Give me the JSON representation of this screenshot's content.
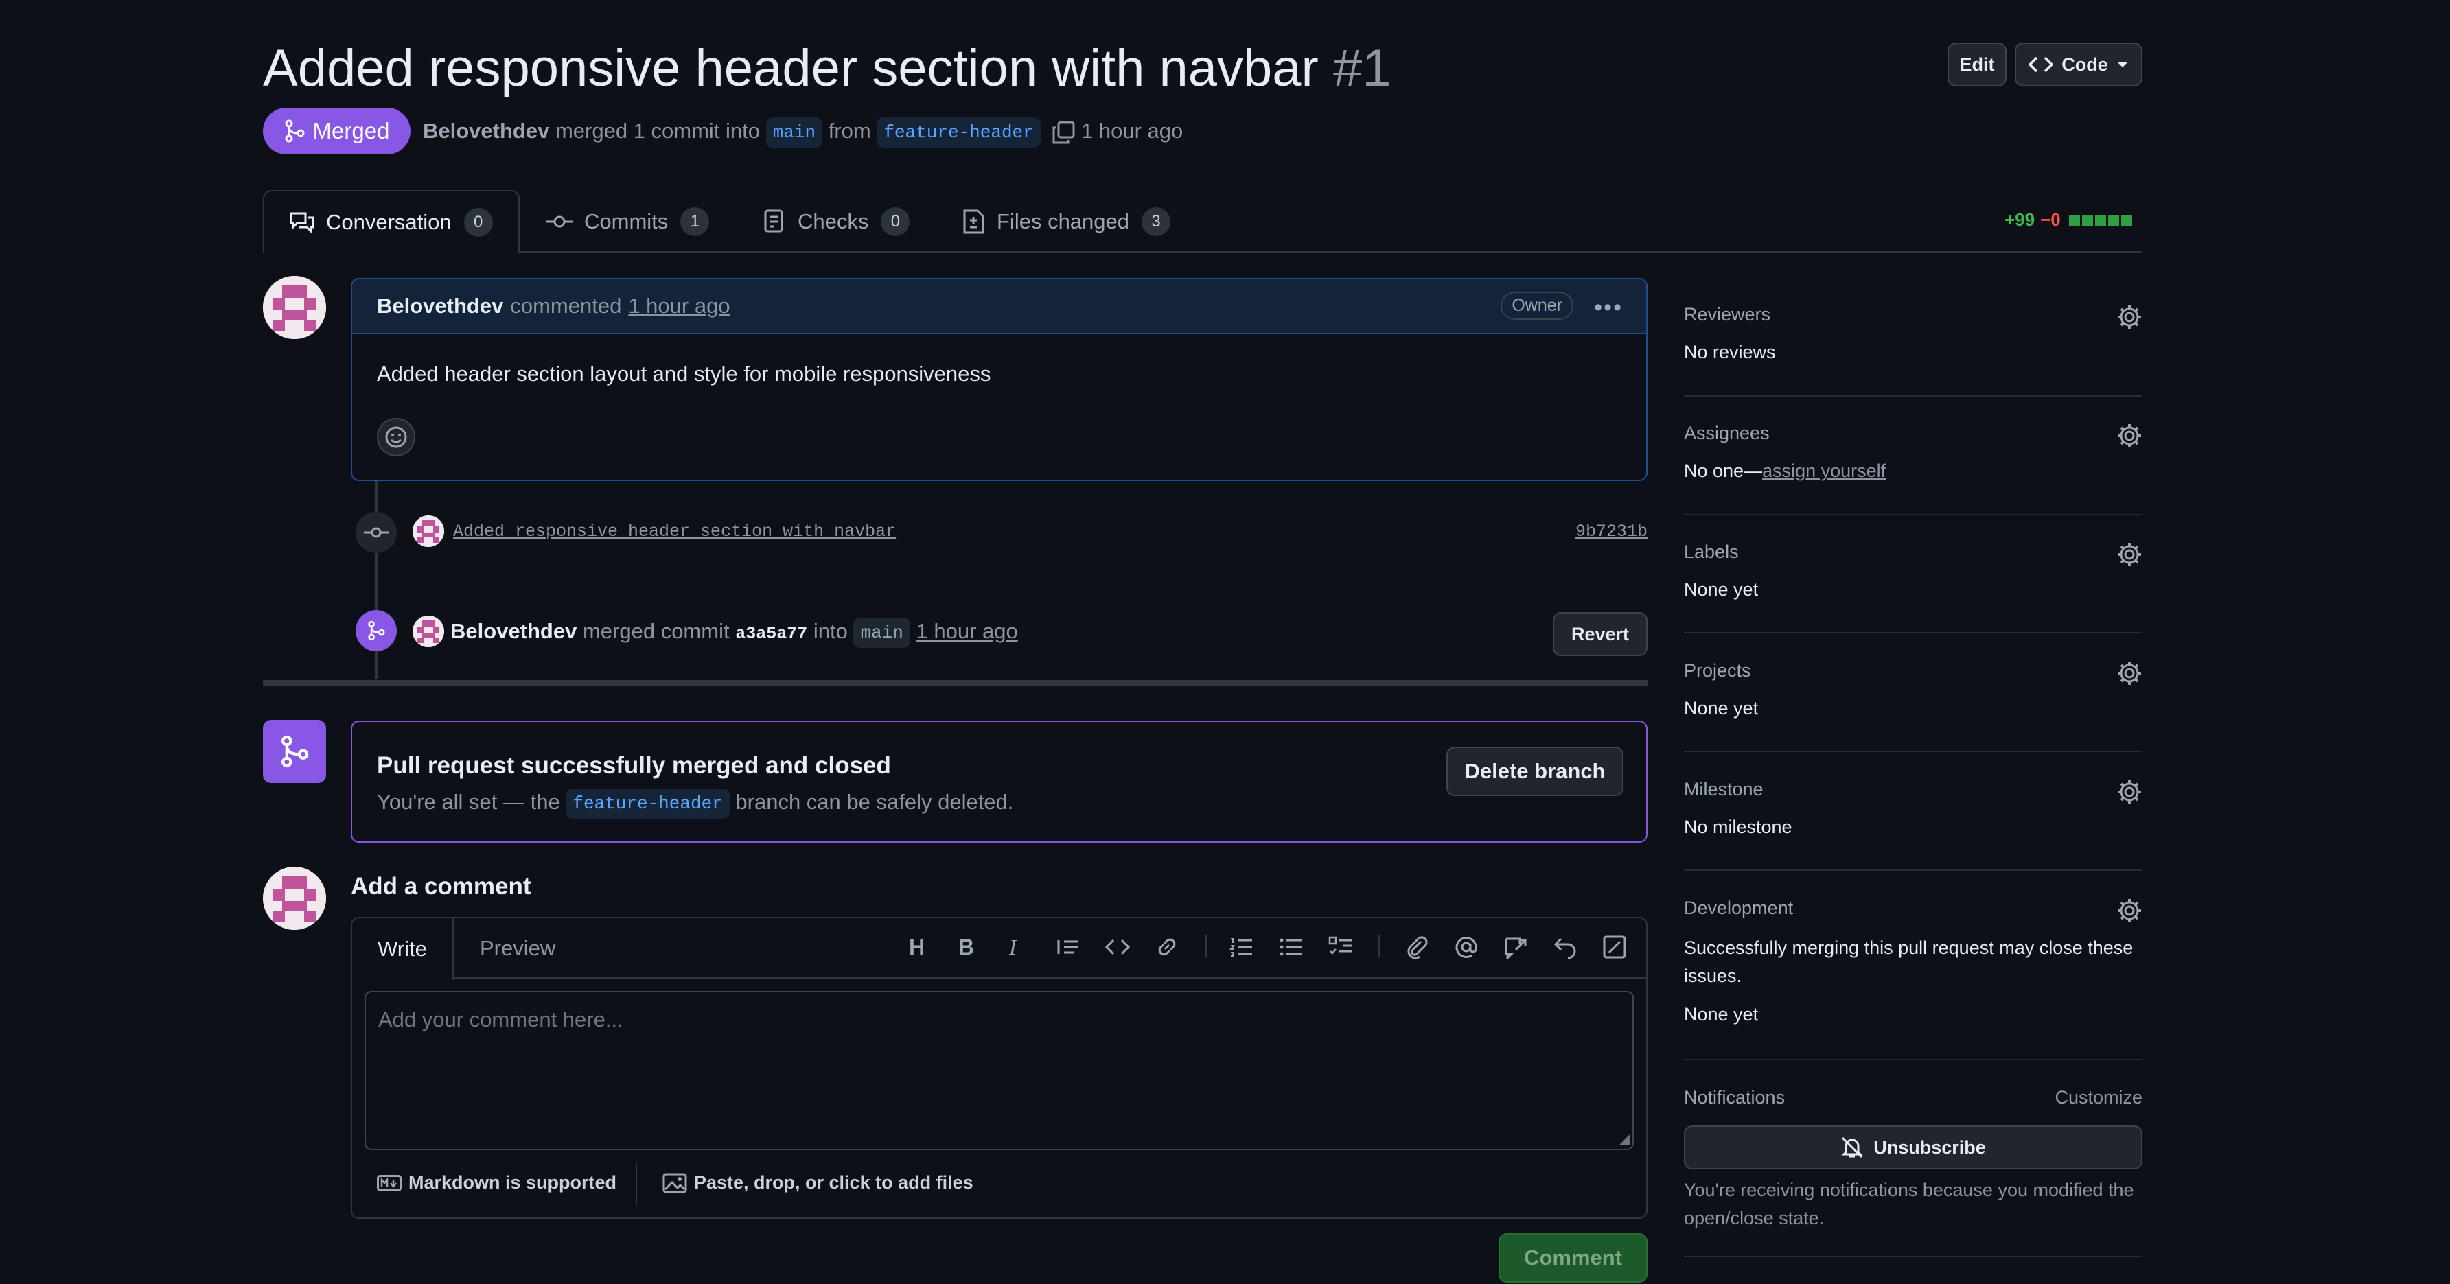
{
  "header": {
    "title": "Added responsive header section with navbar",
    "number": "#1",
    "edit_label": "Edit",
    "code_label": "Code",
    "state_label": "Merged",
    "author": "Belovethdev",
    "merge_text": "merged 1 commit into",
    "base_branch": "main",
    "from_text": "from",
    "head_branch": "feature-header",
    "time": "1 hour ago"
  },
  "tabs": [
    {
      "label": "Conversation",
      "count": "0",
      "icon": "conversation-icon",
      "selected": true
    },
    {
      "label": "Commits",
      "count": "1",
      "icon": "commit-icon"
    },
    {
      "label": "Checks",
      "count": "0",
      "icon": "checklist-icon"
    },
    {
      "label": "Files changed",
      "count": "3",
      "icon": "file-diff-icon"
    }
  ],
  "diffstat": {
    "additions": "+99",
    "deletions": "−0",
    "add_color": "#3fb950",
    "del_color": "#f85149"
  },
  "comment": {
    "author": "Belovethdev",
    "action": "commented",
    "time": "1 hour ago",
    "badge": "Owner",
    "body": "Added header section layout and style for mobile responsiveness"
  },
  "commit": {
    "message": "Added responsive header section with navbar",
    "sha": "9b7231b"
  },
  "merge_event": {
    "author": "Belovethdev",
    "action": "merged commit",
    "sha": "a3a5a77",
    "into": "into",
    "branch": "main",
    "time": "1 hour ago",
    "revert_label": "Revert"
  },
  "merged_box": {
    "title": "Pull request successfully merged and closed",
    "text_before": "You're all set — the",
    "branch": "feature-header",
    "text_after": "branch can be safely deleted.",
    "delete_label": "Delete branch"
  },
  "add_comment": {
    "heading": "Add a comment",
    "tab_write": "Write",
    "tab_preview": "Preview",
    "placeholder": "Add your comment here...",
    "markdown_label": "Markdown is supported",
    "attach_label": "Paste, drop, or click to add files",
    "submit_label": "Comment"
  },
  "sidebar": {
    "reviewers": {
      "title": "Reviewers",
      "value": "No reviews"
    },
    "assignees": {
      "title": "Assignees",
      "value": "No one—",
      "link": "assign yourself"
    },
    "labels": {
      "title": "Labels",
      "value": "None yet"
    },
    "projects": {
      "title": "Projects",
      "value": "None yet"
    },
    "milestone": {
      "title": "Milestone",
      "value": "No milestone"
    },
    "development": {
      "title": "Development",
      "text": "Successfully merging this pull request may close these issues.",
      "value": "None yet"
    },
    "notifications": {
      "title": "Notifications",
      "customize": "Customize",
      "unsubscribe_label": "Unsubscribe",
      "reason": "You're receiving notifications because you modified the open/close state."
    }
  },
  "colors": {
    "merged_purple": "#8957e5",
    "comment_green": "#238636",
    "link_blue": "#58a6ff"
  }
}
